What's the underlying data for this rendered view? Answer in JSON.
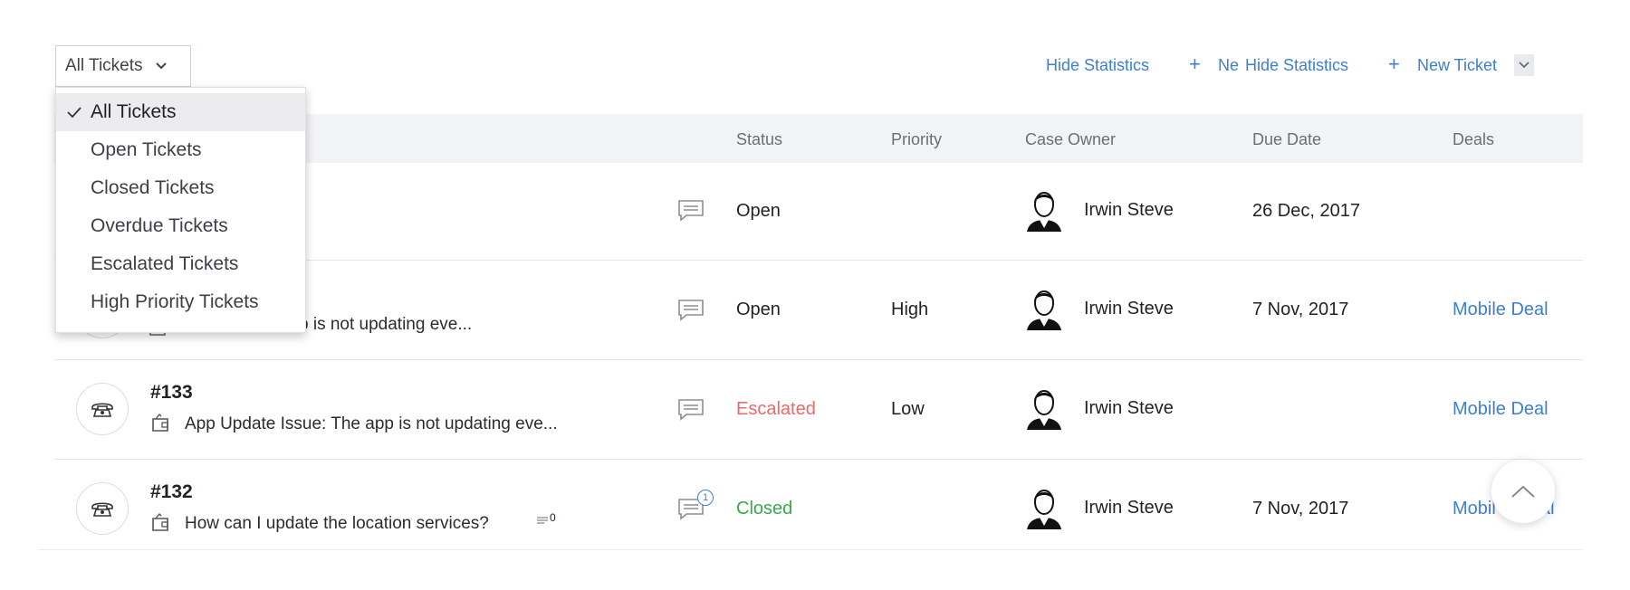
{
  "toolbar": {
    "filter_label": "All Tickets",
    "hide_stats_label": "Hide Statistics",
    "new_ticket_partial": "Ne",
    "new_ticket_label": "New Ticket"
  },
  "dropdown": {
    "options": [
      "All Tickets",
      "Open Tickets",
      "Closed Tickets",
      "Overdue Tickets",
      "Escalated Tickets",
      "High Priority Tickets"
    ],
    "selected": "All Tickets"
  },
  "table": {
    "headers": {
      "status": "Status",
      "priority": "Priority",
      "owner": "Case Owner",
      "due": "Due Date",
      "deals": "Deals"
    },
    "rows": [
      {
        "id": "",
        "subject": "",
        "status": "Open",
        "status_color": "#1f2124",
        "priority": "",
        "owner": "Irwin Steve",
        "due": "26 Dec, 2017",
        "deal": ""
      },
      {
        "id": "",
        "subject": "sue: The app is not updating eve...",
        "status": "Open",
        "status_color": "#1f2124",
        "priority": "High",
        "owner": "Irwin Steve",
        "due": "7 Nov, 2017",
        "deal": "Mobile Deal"
      },
      {
        "id": "#133",
        "subject": "App Update Issue: The app is not updating eve...",
        "status": "Escalated",
        "status_color": "#e86a6a",
        "priority": "Low",
        "owner": "Irwin Steve",
        "due": "",
        "deal": "Mobile Deal"
      },
      {
        "id": "#132",
        "subject": "How can I update the location services?",
        "comment_count": "0",
        "status": "Closed",
        "status_color": "#3aa84a",
        "priority": "",
        "owner": "Irwin Steve",
        "due": "7 Nov, 2017",
        "deal": "Mobil",
        "deal_tail": "al",
        "conversation_badge": "1"
      }
    ]
  },
  "colors": {
    "accent": "#3d7fd3",
    "escalated": "#e86a6a",
    "closed": "#3aa84a"
  }
}
